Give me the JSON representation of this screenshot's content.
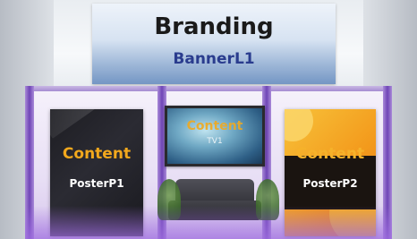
{
  "banner": {
    "title": "Branding",
    "subtitle": "BannerL1"
  },
  "posters": [
    {
      "content_label": "Content",
      "name": "PosterP1"
    },
    {
      "content_label": "Content",
      "name": "PosterP2"
    }
  ],
  "screen": {
    "content_label": "Content",
    "name": "TV1"
  },
  "colors": {
    "accent": "#f2a81d",
    "banner_text": "#2a3c8e",
    "booth_purple": "#6f45b6"
  }
}
